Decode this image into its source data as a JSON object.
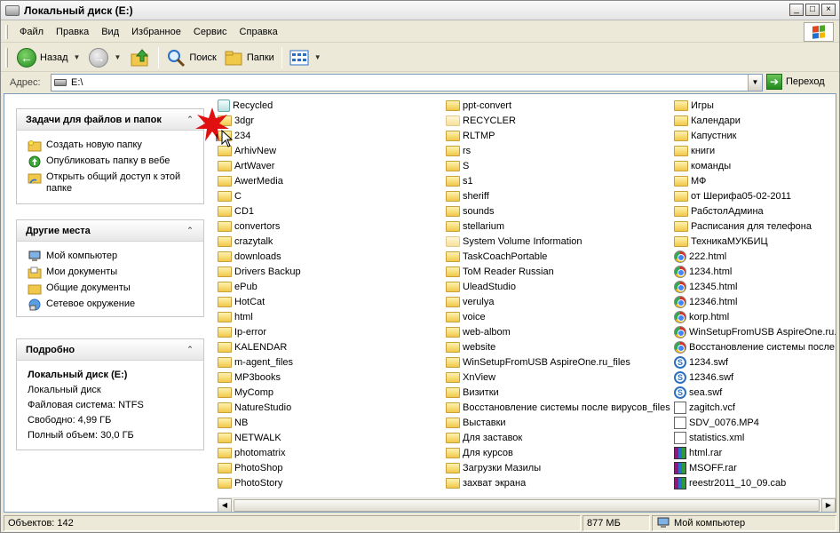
{
  "window": {
    "title": "Локальный диск (E:)"
  },
  "title_buttons": {
    "minimize": "_",
    "maximize": "□",
    "close": "×"
  },
  "menu": [
    "Файл",
    "Правка",
    "Вид",
    "Избранное",
    "Сервис",
    "Справка"
  ],
  "toolbar": {
    "back": "Назад",
    "search": "Поиск",
    "folders": "Папки"
  },
  "address": {
    "label": "Адрес:",
    "value": "E:\\",
    "go": "Переход"
  },
  "panels": {
    "tasks": {
      "title": "Задачи для файлов и папок",
      "items": [
        "Создать новую папку",
        "Опубликовать папку в вебе",
        "Открыть общий доступ к этой папке"
      ]
    },
    "places": {
      "title": "Другие места",
      "items": [
        "Мой компьютер",
        "Мои документы",
        "Общие документы",
        "Сетевое окружение"
      ]
    },
    "details": {
      "title": "Подробно",
      "name": "Локальный диск (E:)",
      "type": "Локальный диск",
      "fs": "Файловая система: NTFS",
      "free": "Свободно: 4,99 ГБ",
      "total": "Полный объем: 30,0 ГБ"
    }
  },
  "columns": [
    [
      {
        "name": "Recycled",
        "type": "recycle"
      },
      {
        "name": "3dgr",
        "type": "folder"
      },
      {
        "name": "234",
        "type": "folder"
      },
      {
        "name": "ArhivNew",
        "type": "folder"
      },
      {
        "name": "ArtWaver",
        "type": "folder"
      },
      {
        "name": "AwerMedia",
        "type": "folder"
      },
      {
        "name": "C",
        "type": "folder"
      },
      {
        "name": "CD1",
        "type": "folder"
      },
      {
        "name": "convertors",
        "type": "folder"
      },
      {
        "name": "crazytalk",
        "type": "folder"
      },
      {
        "name": "downloads",
        "type": "folder"
      },
      {
        "name": "Drivers Backup",
        "type": "folder"
      },
      {
        "name": "ePub",
        "type": "folder"
      },
      {
        "name": "HotCat",
        "type": "folder"
      },
      {
        "name": "html",
        "type": "folder"
      },
      {
        "name": "Ip-error",
        "type": "folder"
      },
      {
        "name": "KALENDAR",
        "type": "folder"
      },
      {
        "name": "m-agent_files",
        "type": "folder"
      },
      {
        "name": "MP3books",
        "type": "folder"
      },
      {
        "name": "MyComp",
        "type": "folder"
      },
      {
        "name": "NatureStudio",
        "type": "folder"
      },
      {
        "name": "NB",
        "type": "folder"
      },
      {
        "name": "NETWALK",
        "type": "folder"
      },
      {
        "name": "photomatrix",
        "type": "folder"
      },
      {
        "name": "PhotoShop",
        "type": "folder"
      },
      {
        "name": "PhotoStory",
        "type": "folder"
      }
    ],
    [
      {
        "name": "ppt-convert",
        "type": "folder"
      },
      {
        "name": "RECYCLER",
        "type": "folder-sys"
      },
      {
        "name": "RLTMP",
        "type": "folder"
      },
      {
        "name": "rs",
        "type": "folder"
      },
      {
        "name": "S",
        "type": "folder"
      },
      {
        "name": "s1",
        "type": "folder"
      },
      {
        "name": "sheriff",
        "type": "folder"
      },
      {
        "name": "sounds",
        "type": "folder"
      },
      {
        "name": "stellarium",
        "type": "folder"
      },
      {
        "name": "System Volume Information",
        "type": "folder-sys"
      },
      {
        "name": "TaskCoachPortable",
        "type": "folder"
      },
      {
        "name": "ToM Reader Russian",
        "type": "folder"
      },
      {
        "name": "UleadStudio",
        "type": "folder"
      },
      {
        "name": "verulya",
        "type": "folder"
      },
      {
        "name": "voice",
        "type": "folder"
      },
      {
        "name": "web-albom",
        "type": "folder"
      },
      {
        "name": "website",
        "type": "folder"
      },
      {
        "name": "WinSetupFromUSB  AspireOne.ru_files",
        "type": "folder"
      },
      {
        "name": "XnView",
        "type": "folder"
      },
      {
        "name": "Визитки",
        "type": "folder"
      },
      {
        "name": "Восстановление системы после вирусов_files",
        "type": "folder"
      },
      {
        "name": "Выставки",
        "type": "folder"
      },
      {
        "name": "Для заставок",
        "type": "folder"
      },
      {
        "name": "Для курсов",
        "type": "folder"
      },
      {
        "name": "Загрузки Мазилы",
        "type": "folder"
      },
      {
        "name": "захват экрана",
        "type": "folder"
      }
    ],
    [
      {
        "name": "Игры",
        "type": "folder"
      },
      {
        "name": "Календари",
        "type": "folder"
      },
      {
        "name": "Капустник",
        "type": "folder"
      },
      {
        "name": "книги",
        "type": "folder"
      },
      {
        "name": "команды",
        "type": "folder"
      },
      {
        "name": "МФ",
        "type": "folder"
      },
      {
        "name": "от Шерифа05-02-2011",
        "type": "folder"
      },
      {
        "name": "РабстолАдмина",
        "type": "folder"
      },
      {
        "name": "Расписания для телефона",
        "type": "folder"
      },
      {
        "name": "ТехникаМУКБИЦ",
        "type": "folder"
      },
      {
        "name": "222.html",
        "type": "chrome"
      },
      {
        "name": "1234.html",
        "type": "chrome"
      },
      {
        "name": "12345.html",
        "type": "chrome"
      },
      {
        "name": "12346.html",
        "type": "chrome"
      },
      {
        "name": "korp.html",
        "type": "chrome"
      },
      {
        "name": "WinSetupFromUSB  AspireOne.ru.h",
        "type": "chrome"
      },
      {
        "name": "Восстановление системы после в",
        "type": "chrome"
      },
      {
        "name": "1234.swf",
        "type": "swf"
      },
      {
        "name": "12346.swf",
        "type": "swf"
      },
      {
        "name": "sea.swf",
        "type": "swf"
      },
      {
        "name": "zagitch.vcf",
        "type": "vcf"
      },
      {
        "name": "SDV_0076.MP4",
        "type": "mp4"
      },
      {
        "name": "statistics.xml",
        "type": "xml"
      },
      {
        "name": "html.rar",
        "type": "rar"
      },
      {
        "name": "MSOFF.rar",
        "type": "rar"
      },
      {
        "name": "reestr2011_10_09.cab",
        "type": "rar"
      }
    ]
  ],
  "status": {
    "objects": "Объектов: 142",
    "size": "877 МБ",
    "location": "Мой компьютер"
  }
}
